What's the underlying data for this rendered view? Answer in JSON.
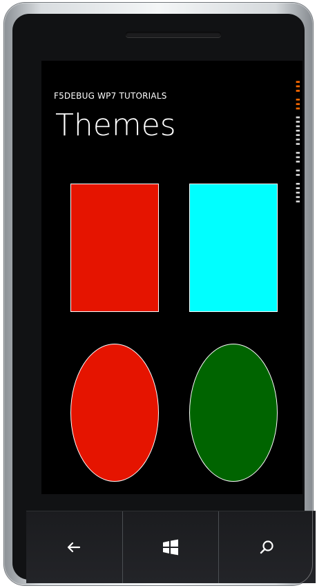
{
  "device": {
    "buttons": {
      "back": "back-arrow-icon",
      "start": "windows-logo-icon",
      "search": "search-icon"
    }
  },
  "app": {
    "app_title": "F5DEBUG WP7 TUTORIALS",
    "page_title": "Themes",
    "frame_counter_visible": true
  },
  "shapes": {
    "rectangles": [
      {
        "name": "left-rectangle",
        "color": "#E51400"
      },
      {
        "name": "right-rectangle",
        "color": "#00FFFF"
      }
    ],
    "ellipses": [
      {
        "name": "left-ellipse",
        "color": "#E51400"
      },
      {
        "name": "right-ellipse",
        "color": "#006400"
      }
    ]
  },
  "colors": {
    "background": "#000000",
    "accent": "#E51400",
    "text": "#FFFFFF"
  }
}
